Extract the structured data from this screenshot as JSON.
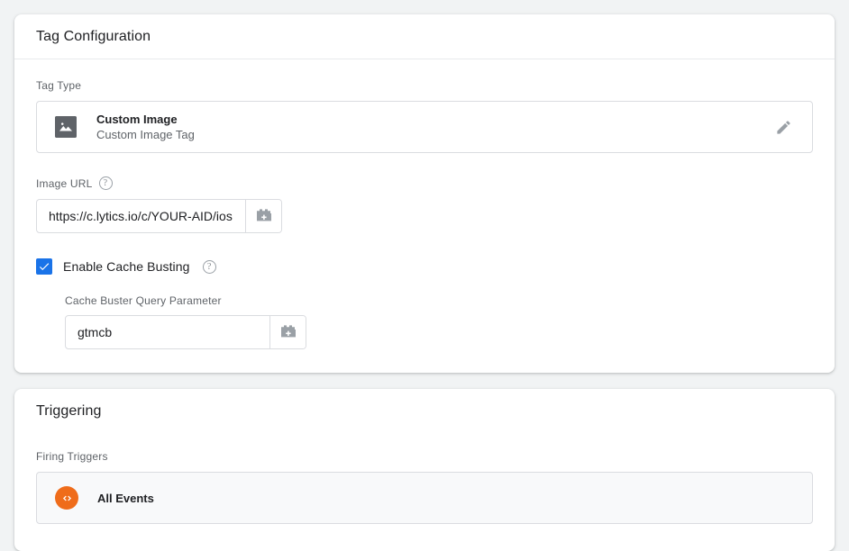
{
  "tag_configuration": {
    "title": "Tag Configuration",
    "tag_type": {
      "label": "Tag Type",
      "icon": "image-icon",
      "name": "Custom Image",
      "description": "Custom Image Tag",
      "edit_icon": "pencil-icon"
    },
    "image_url": {
      "label": "Image URL",
      "help_icon": "help-circle-icon",
      "value": "https://c.lytics.io/c/YOUR-AID/ios",
      "variable_button_icon": "variable-brick-icon"
    },
    "cache_busting": {
      "label": "Enable Cache Busting",
      "checked": true,
      "check_icon": "checkmark-icon",
      "help_icon": "help-circle-icon",
      "accent_color": "#1a73e8"
    },
    "cache_buster_param": {
      "label": "Cache Buster Query Parameter",
      "value": "gtmcb",
      "variable_button_icon": "variable-brick-icon"
    }
  },
  "triggering": {
    "title": "Triggering",
    "firing_triggers_label": "Firing Triggers",
    "triggers": [
      {
        "name": "All Events",
        "icon": "code-brackets-icon",
        "icon_color": "#ef6c1a"
      }
    ]
  }
}
